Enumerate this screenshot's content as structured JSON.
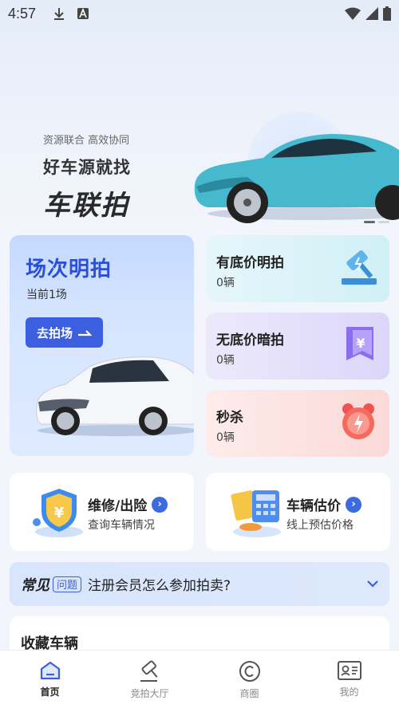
{
  "status_bar": {
    "time": "4:57"
  },
  "hero": {
    "tagline": "资源联合 高效协同",
    "title": "好车源就找",
    "brand": "车联拍"
  },
  "auction_main": {
    "title": "场次明拍",
    "subtitle": "当前1场",
    "button_label": "去拍场"
  },
  "auction_types": [
    {
      "label": "有底价明拍",
      "count": "0辆"
    },
    {
      "label": "无底价暗拍",
      "count": "0辆"
    },
    {
      "label": "秒杀",
      "count": "0辆"
    }
  ],
  "services": [
    {
      "title": "维修/出险",
      "subtitle": "查询车辆情况"
    },
    {
      "title": "车辆估价",
      "subtitle": "线上预估价格"
    }
  ],
  "faq": {
    "tag_main": "常见",
    "tag_box": "问题",
    "question": "注册会员怎么参加拍卖?"
  },
  "favorites": {
    "title": "收藏车辆"
  },
  "tabbar": [
    {
      "label": "首页",
      "icon": "home-icon",
      "active": true
    },
    {
      "label": "竞拍大厅",
      "icon": "gavel-icon",
      "active": false
    },
    {
      "label": "商圈",
      "icon": "copyright-circle-icon",
      "active": false
    },
    {
      "label": "我的",
      "icon": "id-card-icon",
      "active": false
    }
  ],
  "colors": {
    "accent": "#3c5fe0",
    "title_blue": "#2b4fd8"
  }
}
